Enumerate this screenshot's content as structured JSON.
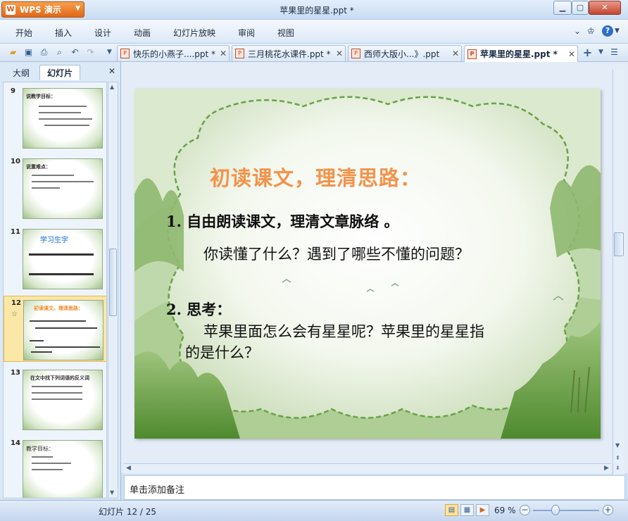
{
  "window": {
    "app_button": "WPS 演示",
    "title": "苹果里的星星.ppt *"
  },
  "menu": [
    "开始",
    "插入",
    "设计",
    "动画",
    "幻灯片放映",
    "审阅",
    "视图"
  ],
  "tabs": [
    {
      "label": "快乐的小燕子....ppt *",
      "active": false
    },
    {
      "label": "三月桃花水课件.ppt *",
      "active": false
    },
    {
      "label": "西师大版小...》.ppt",
      "active": false
    },
    {
      "label": "苹果里的星星.ppt *",
      "active": true
    }
  ],
  "left_panel": {
    "tab_outline": "大纲",
    "tab_slides": "幻灯片",
    "thumbnails": [
      {
        "num": "9",
        "title": "说教学目标："
      },
      {
        "num": "10",
        "title": "说重难点："
      },
      {
        "num": "11",
        "title": "学习生字"
      },
      {
        "num": "12",
        "title": "初读课文，理清思路："
      },
      {
        "num": "13",
        "title": "在文中找下列词语的反义词"
      },
      {
        "num": "14",
        "title": "教学目标："
      }
    ]
  },
  "slide": {
    "title": "初读课文，理清思路：",
    "line1": "1. 自由朗读课文，理清文章脉络  。",
    "line2": "你读懂了什么？遇到了哪些不懂的问题？",
    "line3": "2. 思考：",
    "line4": "苹果里面怎么会有星星呢？苹果里的星星指",
    "line5": "的是什么？"
  },
  "notes_placeholder": "单击添加备注",
  "status": {
    "slide_counter": "幻灯片 12 / 25",
    "zoom": "69 %"
  },
  "colors": {
    "title_orange": "#f4924a",
    "app_button_orange": "#e0671a",
    "selection_yellow": "#fbe7a6"
  }
}
